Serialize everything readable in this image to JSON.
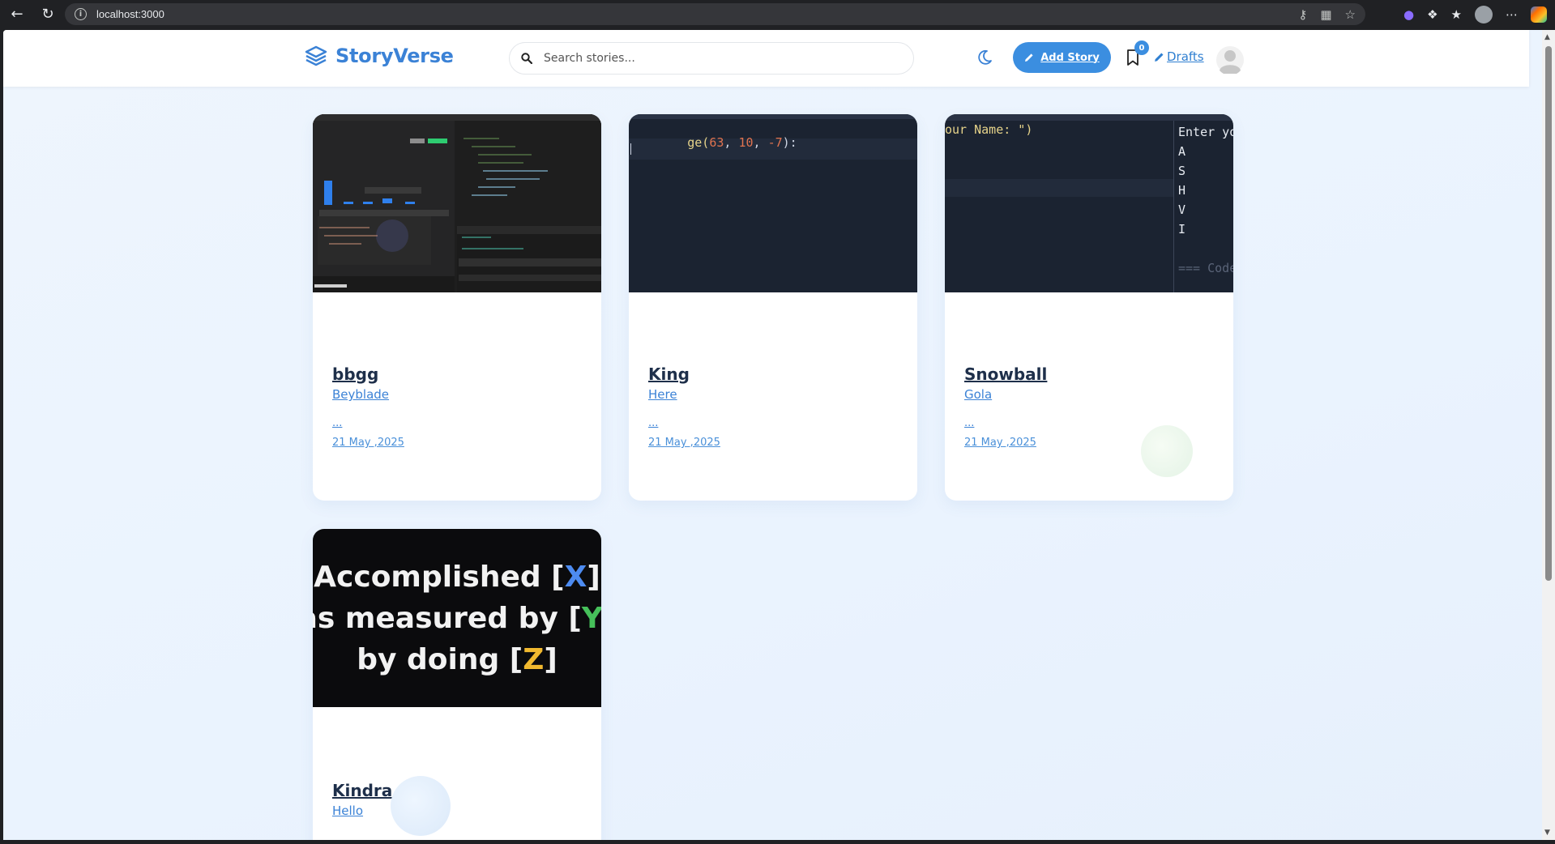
{
  "browser": {
    "url": "localhost:3000"
  },
  "header": {
    "logo_text": "StoryVerse",
    "search_placeholder": "Search stories...",
    "add_story_label": "Add Story",
    "bookmark_count": "0",
    "drafts_label": "Drafts"
  },
  "cards": [
    {
      "title": "bbgg",
      "subtitle": "Beyblade",
      "excerpt": "...",
      "date": "21 May ,2025",
      "image_kind": "ide-screenshot"
    },
    {
      "title": "King",
      "subtitle": "Here",
      "excerpt": "...",
      "date": "21 May ,2025",
      "image_kind": "code-screenshot",
      "code": {
        "prefix": "ge(",
        "n1": "63",
        "sep1": ", ",
        "n2": "10",
        "sep2": ", ",
        "n3": "-7",
        "suffix": "):"
      }
    },
    {
      "title": "Snowball",
      "subtitle": "Gola",
      "excerpt": "...",
      "date": "21 May ,2025",
      "image_kind": "code-screenshot",
      "code": {
        "left_line": "our Name: \")",
        "right_lines": [
          "Enter yo",
          "A",
          "S",
          "H",
          "V",
          "I"
        ],
        "footer": "=== Code"
      }
    },
    {
      "title": "Kindra",
      "subtitle": "Hello",
      "image_kind": "text-graphic",
      "graphic": {
        "line1_a": "Accomplished [",
        "line1_x": "X",
        "line1_b": "]",
        "line2_a": "as measured by [",
        "line2_y": "Y",
        "line2_b": "]",
        "line3_a": "by doing [",
        "line3_z": "Z",
        "line3_b": "]"
      }
    }
  ],
  "colors": {
    "brand": "#3b82d6",
    "button": "#3b8ee0",
    "title": "#1e2f4a",
    "page_bg": "#eef5fd"
  },
  "icons": {
    "logo": "layers-icon",
    "search": "search-icon",
    "theme": "moon-icon",
    "add": "pencil-icon",
    "bookmark": "bookmark-icon",
    "drafts": "pencil-icon",
    "avatar": "user-avatar-icon"
  }
}
